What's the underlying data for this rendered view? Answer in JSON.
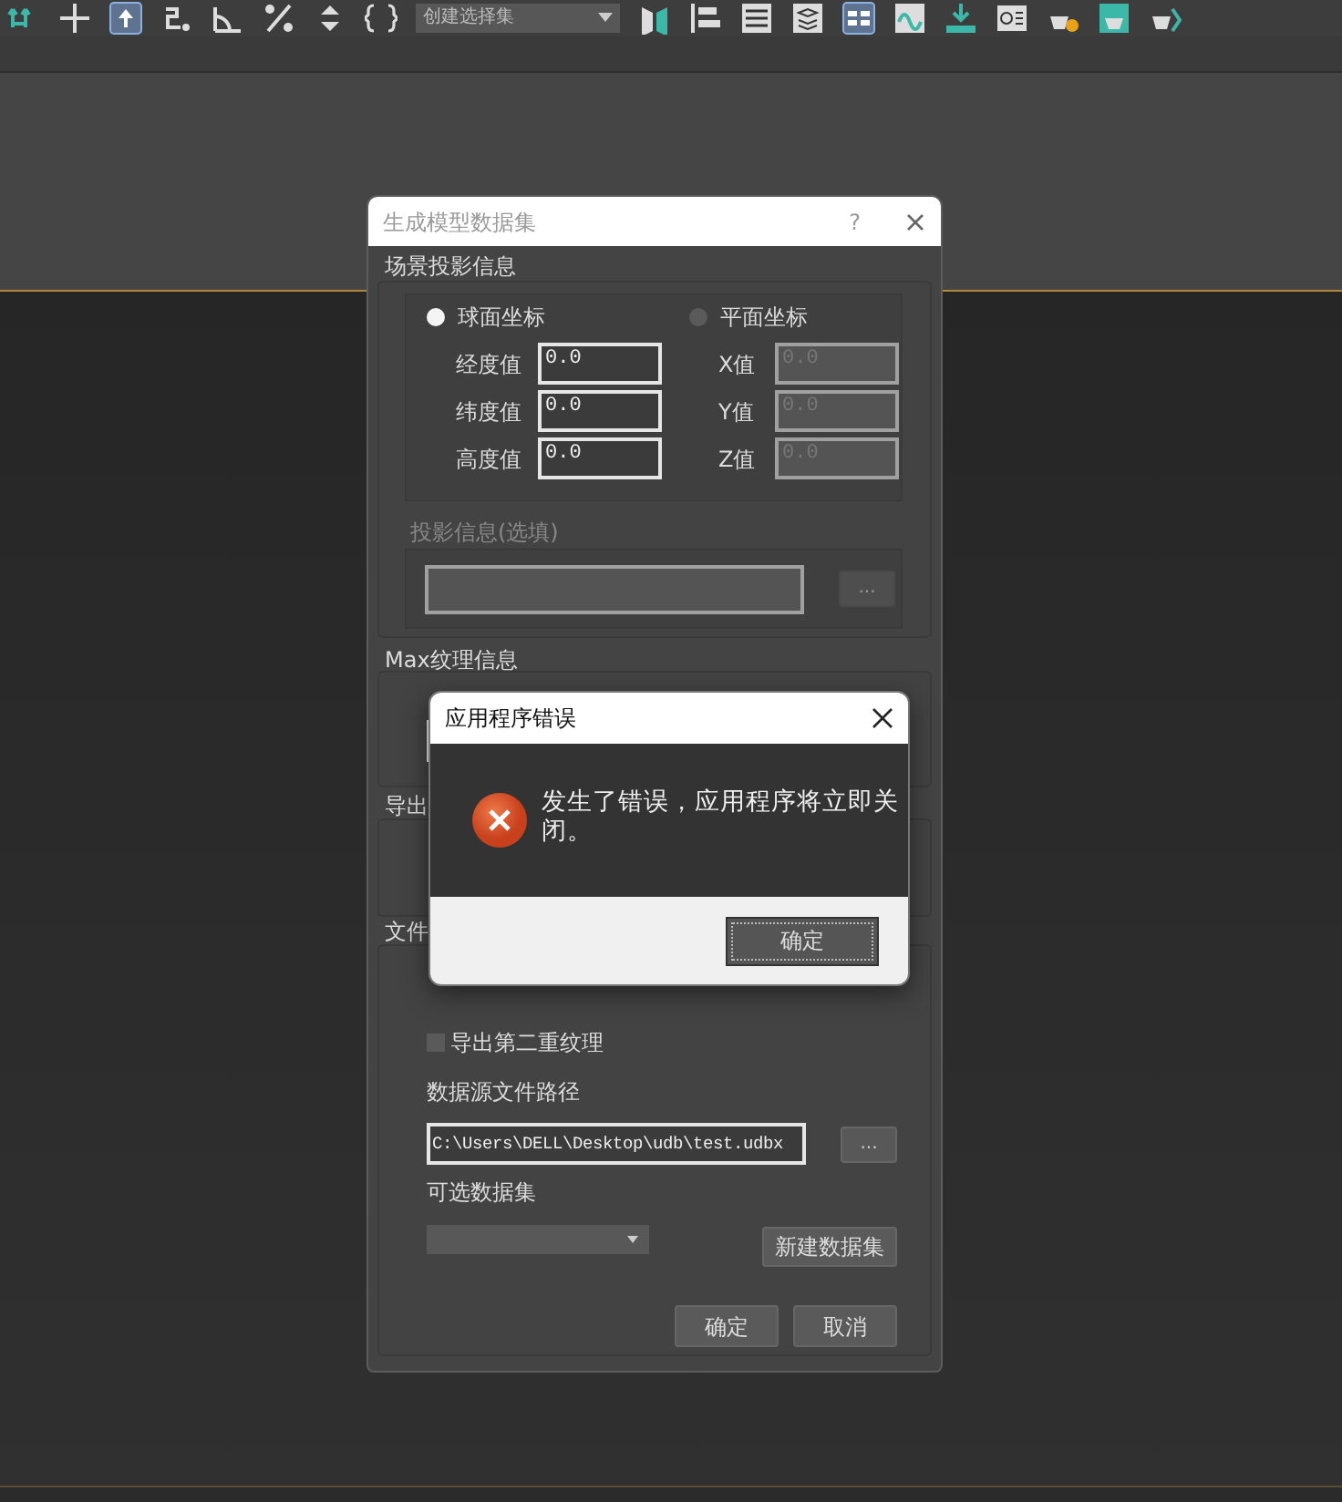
{
  "toolbar": {
    "selection_set": "创建选择集"
  },
  "dialog": {
    "title": "生成模型数据集",
    "help": "?",
    "projection_group": {
      "label": "场景投影信息",
      "modes": [
        {
          "label": "球面坐标",
          "selected": true,
          "fields": [
            {
              "label": "经度值",
              "value": "0.0"
            },
            {
              "label": "纬度值",
              "value": "0.0"
            },
            {
              "label": "高度值",
              "value": "0.0"
            }
          ]
        },
        {
          "label": "平面坐标",
          "selected": false,
          "fields": [
            {
              "label": "X值",
              "value": "0.0"
            },
            {
              "label": "Y值",
              "value": "0.0"
            },
            {
              "label": "Z值",
              "value": "0.0"
            }
          ]
        }
      ],
      "optional": {
        "label": "投影信息(选填)",
        "disabled": true,
        "browse": "..."
      }
    },
    "texture_group": {
      "label": "Max纹理信息"
    },
    "export_group": {
      "label": "导出"
    },
    "file_group": {
      "label": "文件",
      "second_texture": {
        "label": "导出第二重纹理",
        "checked": false
      },
      "source_label": "数据源文件路径",
      "source_path": "C:\\Users\\DELL\\Desktop\\udb\\test.udbx",
      "browse": "...",
      "dataset_label": "可选数据集",
      "new_dataset": "新建数据集"
    },
    "buttons": [
      "确定",
      "取消"
    ]
  },
  "error_dialog": {
    "title": "应用程序错误",
    "message": "发生了错误，应用程序将立即关闭。",
    "ok": "确定"
  }
}
